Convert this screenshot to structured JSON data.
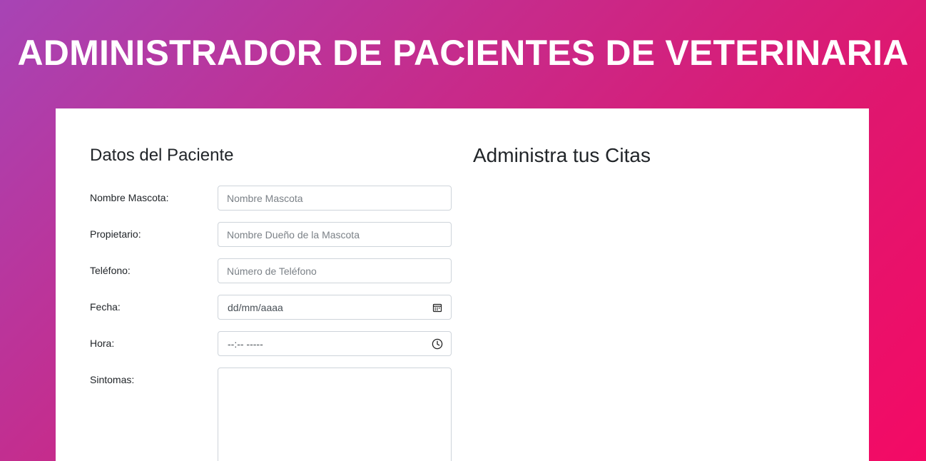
{
  "header": {
    "title": "ADMINISTRADOR DE PACIENTES DE VETERINARIA"
  },
  "form": {
    "title": "Datos del Paciente",
    "fields": {
      "mascota": {
        "label": "Nombre Mascota:",
        "placeholder": "Nombre Mascota",
        "value": ""
      },
      "propietario": {
        "label": "Propietario:",
        "placeholder": "Nombre Dueño de la Mascota",
        "value": ""
      },
      "telefono": {
        "label": "Teléfono:",
        "placeholder": "Número de Teléfono",
        "value": ""
      },
      "fecha": {
        "label": "Fecha:",
        "display": "dd/mm/aaaa",
        "icon": "calendar-icon"
      },
      "hora": {
        "label": "Hora:",
        "display": "--:-- -----",
        "icon": "clock-icon"
      },
      "sintomas": {
        "label": "Sintomas:",
        "value": ""
      }
    }
  },
  "citas": {
    "title": "Administra tus Citas"
  },
  "colors": {
    "gradient_start": "#a744b5",
    "gradient_end": "#f40a65",
    "card_background": "#ffffff",
    "input_border": "#ced4da"
  }
}
